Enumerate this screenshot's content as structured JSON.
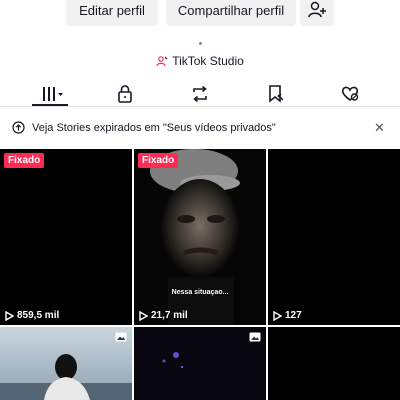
{
  "profile_actions": {
    "edit_label": "Editar perfil",
    "share_label": "Compartilhar perfil"
  },
  "studio": {
    "label": "TikTok Studio"
  },
  "tabs": [
    {
      "icon": "grid-icon",
      "active": true
    },
    {
      "icon": "lock-icon"
    },
    {
      "icon": "repost-icon"
    },
    {
      "icon": "bookmark-icon"
    },
    {
      "icon": "liked-icon"
    }
  ],
  "notice": {
    "text": "Veja Stories expirados em \"Seus vídeos privados\""
  },
  "videos": [
    {
      "pinned_label": "Fixado",
      "views": "859,5 mil"
    },
    {
      "pinned_label": "Fixado",
      "views": "21,7 mil",
      "caption": "Nessa situaçao..."
    },
    {
      "views": "127"
    },
    {
      "type": "photo"
    },
    {
      "type": "photo"
    },
    {}
  ],
  "colors": {
    "accent": "#fe2c55",
    "text": "#161823"
  }
}
